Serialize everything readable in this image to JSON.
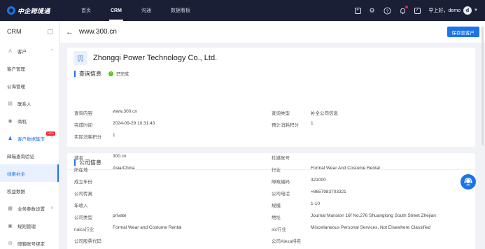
{
  "topbar": {
    "logo_text": "中企跨境通",
    "nav": [
      "首页",
      "CRM",
      "沟通",
      "数据看板"
    ],
    "greeting": "早上好，demo",
    "avatar_letter": "d",
    "icons": [
      "expand-icon",
      "settings-icon",
      "help-icon",
      "bell-icon",
      "checkbox-icon"
    ]
  },
  "sidebar": {
    "title": "CRM",
    "items": [
      {
        "label": "客户",
        "icon": "user-icon",
        "chevron": "^"
      },
      {
        "label": "客户管理"
      },
      {
        "label": "公海管理"
      },
      {
        "label": "联系人",
        "icon": "contact-card-icon"
      },
      {
        "label": "商机",
        "icon": "location-pin-icon"
      },
      {
        "label": "客户数据集市",
        "icon": "users-icon",
        "chevron": "^",
        "badge": "NEW"
      },
      {
        "label": "邮箱查询验证"
      },
      {
        "label": "线索补全"
      },
      {
        "label": "权益数据"
      },
      {
        "label": "业务参数设置",
        "icon": "grid-icon",
        "chevron": "v"
      },
      {
        "label": "规则管理",
        "icon": "rules-icon"
      },
      {
        "label": "邮箱账号绑定",
        "icon": "mail-icon"
      }
    ]
  },
  "header": {
    "back_label": "←",
    "title": "www.300.cn",
    "save_label": "保存至客户"
  },
  "company": {
    "name": "Zhongqi Power Technology Co., Ltd."
  },
  "query": {
    "section_title": "查询信息",
    "status_label": "已完成",
    "fields": [
      {
        "key": "查询内容",
        "value": "www.300.cn"
      },
      {
        "key": "查询类型",
        "value": "补全公司信息"
      },
      {
        "key": "完成时间",
        "value": "2024-09-29 10:31:43"
      },
      {
        "key": "预计消耗积分",
        "value": "1"
      },
      {
        "key": "实际消耗积分",
        "value": "1"
      }
    ]
  },
  "company_info": {
    "section_title": "公司信息",
    "fields": [
      {
        "key": "域名",
        "value": "300.cn"
      },
      {
        "key": "社媒账号",
        "value": ""
      },
      {
        "key": "所在地",
        "value": "Asia/China"
      },
      {
        "key": "行业",
        "value": "Formal Wear And Costume Rental"
      },
      {
        "key": "成立年份",
        "value": ""
      },
      {
        "key": "邮政编码",
        "value": "321000"
      },
      {
        "key": "公司传真",
        "value": ""
      },
      {
        "key": "公司电话",
        "value": "+8657983703321"
      },
      {
        "key": "年收入",
        "value": ""
      },
      {
        "key": "规模",
        "value": "1-10"
      },
      {
        "key": "公司类型",
        "value": "private"
      },
      {
        "key": "地址",
        "value": "Journal Mansion 16f No.276 Shuanglong South Street Zhejian"
      },
      {
        "key": "naics行业",
        "value": "Formal Wear and Costume Rental"
      },
      {
        "key": "sic行业",
        "value": "Miscellaneous Personal Services, Not Elsewhere Classified"
      },
      {
        "key": "公司股票代码",
        "value": ""
      },
      {
        "key": "公司Alexa排名",
        "value": ""
      }
    ]
  },
  "colors": {
    "accent": "#1c74e8",
    "topbar": "#1a1f36",
    "success": "#52c41a"
  }
}
